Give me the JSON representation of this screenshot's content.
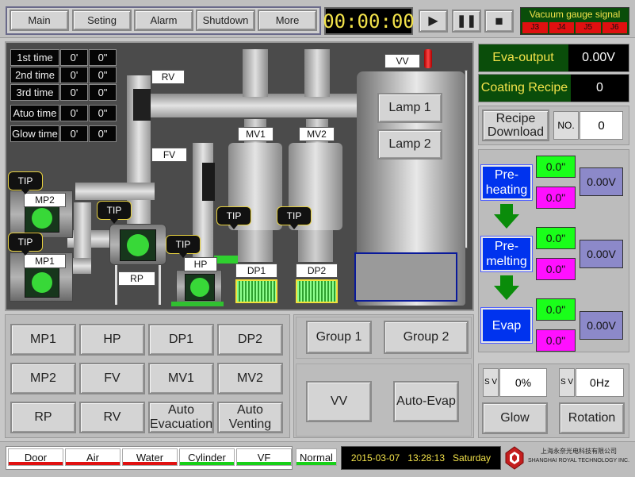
{
  "topnav": {
    "main": "Main",
    "setting": "Seting",
    "alarm": "Alarm",
    "shutdown": "Shutdown",
    "more": "More"
  },
  "timer": "00:00:00",
  "vacuum": {
    "title": "Vacuum gauge signal",
    "channels": [
      "J3",
      "J4",
      "J5",
      "J6"
    ]
  },
  "times": [
    {
      "label": "1st time",
      "min": "0'",
      "sec": "0\""
    },
    {
      "label": "2nd time",
      "min": "0'",
      "sec": "0\""
    },
    {
      "label": "3rd time",
      "min": "0'",
      "sec": "0\""
    },
    {
      "label": "Atuo time",
      "min": "0'",
      "sec": "0\""
    },
    {
      "label": "Glow time",
      "min": "0'",
      "sec": "0\""
    }
  ],
  "schematic": {
    "rv": "RV",
    "fv": "FV",
    "vv": "VV",
    "mv1": "MV1",
    "mv2": "MV2",
    "mp2": "MP2",
    "mp1": "MP1",
    "rp": "RP",
    "hp": "HP",
    "dp1": "DP1",
    "dp2": "DP2",
    "tip": "TIP",
    "lamp1": "Lamp 1",
    "lamp2": "Lamp 2"
  },
  "valves": {
    "mp1": "MP1",
    "hp": "HP",
    "dp1": "DP1",
    "dp2": "DP2",
    "mp2": "MP2",
    "fv": "FV",
    "mv1": "MV1",
    "mv2": "MV2",
    "rp": "RP",
    "rv": "RV",
    "auto_evac": "Auto Evacuation",
    "auto_vent": "Auto Venting"
  },
  "groups": {
    "g1": "Group 1",
    "g2": "Group 2",
    "vv": "VV",
    "auto_evap": "Auto-Evap"
  },
  "eva_output": {
    "label": "Eva-output",
    "value": "0.00V"
  },
  "coating_recipe": {
    "label": "Coating Recipe",
    "value": "0"
  },
  "recipe_download": {
    "label": "Recipe Download",
    "no_label": "NO.",
    "no_value": "0"
  },
  "stages": [
    {
      "label": "Pre-heating",
      "t1": "0.0\"",
      "t2": "0.0\"",
      "voltage": "0.00V"
    },
    {
      "label": "Pre-melting",
      "t1": "0.0\"",
      "t2": "0.0\"",
      "voltage": "0.00V"
    },
    {
      "label": "Evap",
      "t1": "0.0\"",
      "t2": "0.0\"",
      "voltage": "0.00V"
    }
  ],
  "glow": {
    "sv": "S V",
    "value": "0%",
    "label": "Glow"
  },
  "rotation": {
    "sv": "S V",
    "value": "0Hz",
    "label": "Rotation"
  },
  "status": [
    {
      "label": "Door",
      "color": "#e01010"
    },
    {
      "label": "Air",
      "color": "#e01010"
    },
    {
      "label": "Water",
      "color": "#e01010"
    },
    {
      "label": "Cylinder",
      "color": "#18d018"
    },
    {
      "label": "VF",
      "color": "#18d018"
    },
    {
      "label": "Normal",
      "color": "#18d018"
    }
  ],
  "datetime": "2015-03-07   13:28:13   Saturday",
  "company": {
    "cn": "上海永奈光电科技有限公司",
    "en": "SHANGHAI ROYAL TECHNOLOGY INC."
  },
  "colors": {
    "blue_stage": "#0033ee",
    "green": "#1aff1a",
    "magenta": "#ff10ff",
    "violet": "#8c89c9",
    "panel_green": "#0a4d0a"
  }
}
